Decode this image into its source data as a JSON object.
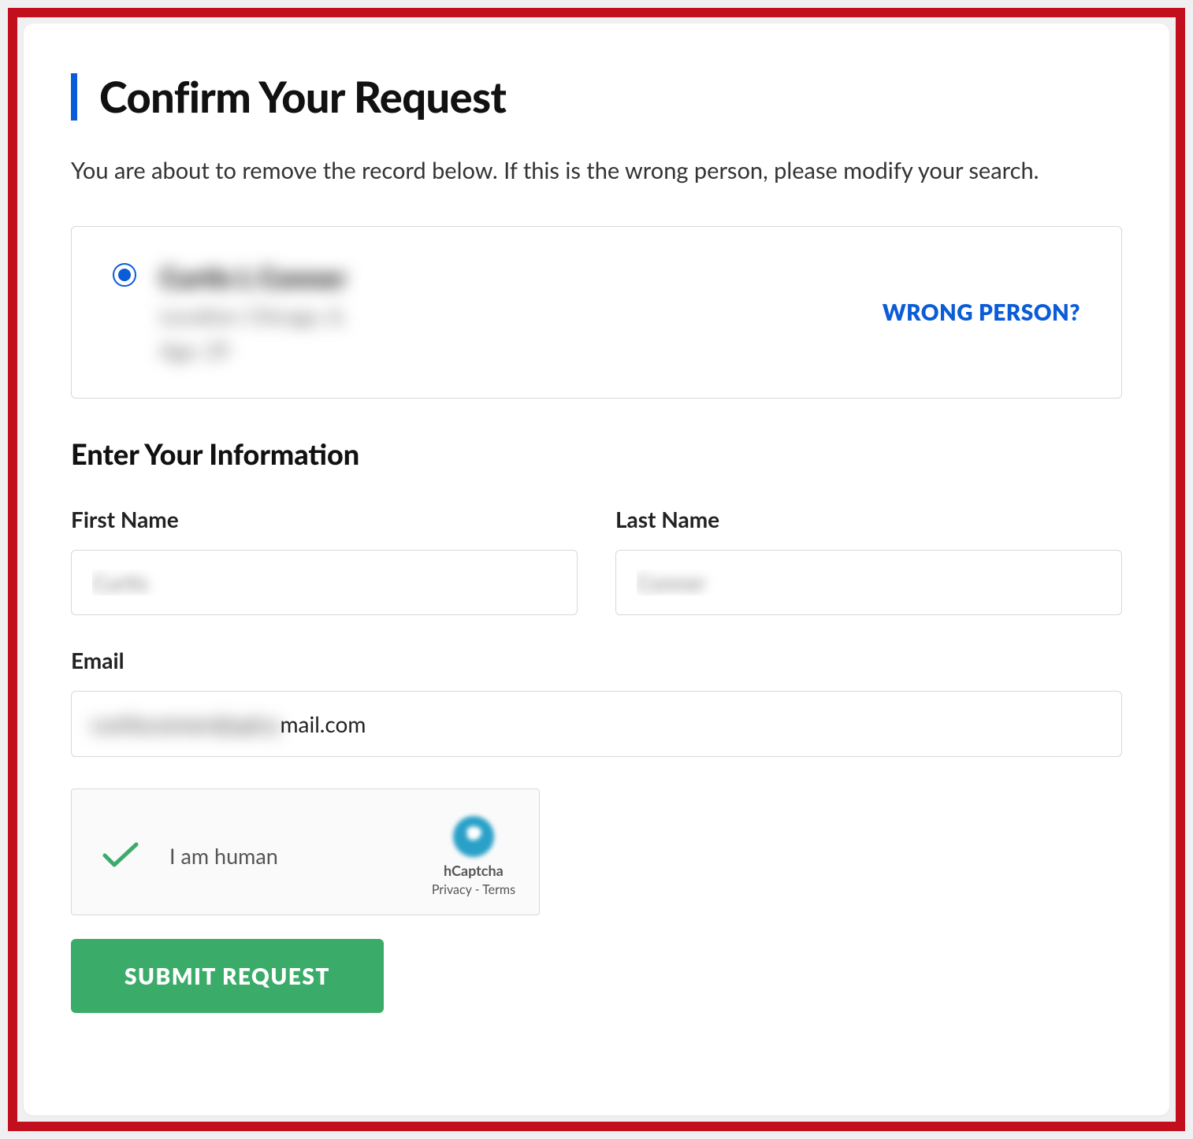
{
  "header": {
    "title": "Confirm Your Request",
    "subtitle": "You are about to remove the record below. If this is the wrong person, please modify your search."
  },
  "record": {
    "name": "Curtis L Conner",
    "location_label": "Location:",
    "location_value": "Chicago, IL",
    "age_label": "Age:",
    "age_value": "29",
    "wrong_link": "WRONG PERSON?"
  },
  "form": {
    "section_title": "Enter Your Information",
    "first_name_label": "First Name",
    "first_name_value": "Curtis",
    "last_name_label": "Last Name",
    "last_name_value": "Conner",
    "email_label": "Email",
    "email_blurred_part": "curtisconner@spicy",
    "email_visible_part": "mail.com"
  },
  "captcha": {
    "label": "I am human",
    "brand": "hCaptcha",
    "privacy": "Privacy",
    "terms": "Terms",
    "separator": " - "
  },
  "submit": {
    "label": "SUBMIT REQUEST"
  }
}
